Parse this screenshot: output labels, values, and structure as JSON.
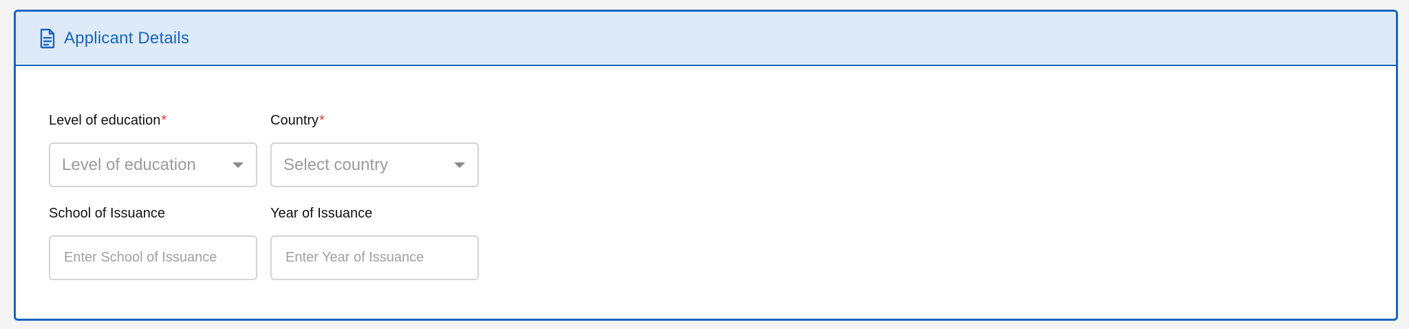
{
  "card": {
    "title": "Applicant Details",
    "icon": "document-icon"
  },
  "form": {
    "education": {
      "label": "Level of education",
      "required_mark": "*",
      "placeholder": "Level of education"
    },
    "country": {
      "label": "Country",
      "required_mark": "*",
      "placeholder": "Select country"
    },
    "school": {
      "label": "School of Issuance",
      "placeholder": "Enter School of Issuance",
      "value": ""
    },
    "year": {
      "label": "Year of Issuance",
      "placeholder": "Enter Year of Issuance",
      "value": ""
    }
  },
  "colors": {
    "accent": "#1565c0",
    "header_bg": "#deeaf8",
    "required": "#e53935",
    "placeholder": "#9b9b9b",
    "border": "#d4d4d4"
  }
}
